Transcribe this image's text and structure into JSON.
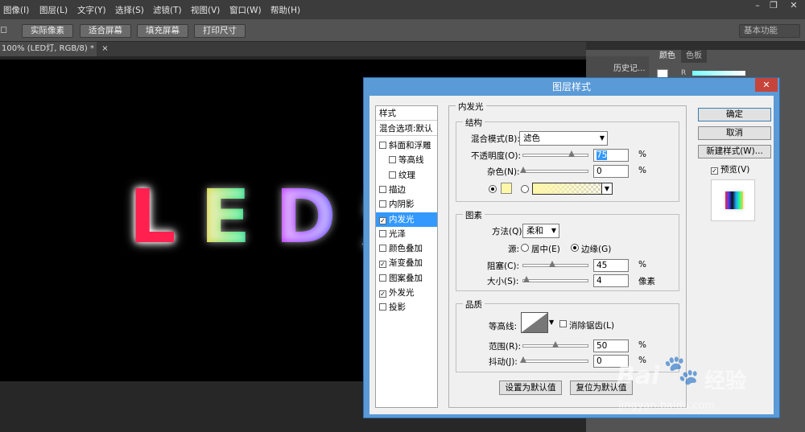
{
  "menu": [
    "图像(I)",
    "图层(L)",
    "文字(Y)",
    "选择(S)",
    "滤镜(T)",
    "视图(V)",
    "窗口(W)",
    "帮助(H)"
  ],
  "options_bar": {
    "buttons": [
      "实际像素",
      "适合屏幕",
      "填充屏幕",
      "打印尺寸"
    ],
    "workspace": "基本功能"
  },
  "document_tab": {
    "title": "100% (LED灯, RGB/8) *",
    "close": "×"
  },
  "canvas_text": "LED灯",
  "right_panel": {
    "history_tab": "历史记...",
    "color_tab": "颜色",
    "swatches_tab": "色板",
    "r_label": "R"
  },
  "dialog": {
    "title": "图层样式",
    "close": "✕",
    "styles_header": "样式",
    "blend_default": "混合选项:默认",
    "styles": [
      {
        "label": "斜面和浮雕",
        "checked": false,
        "indent": false,
        "selected": false
      },
      {
        "label": "等高线",
        "checked": false,
        "indent": true,
        "selected": false
      },
      {
        "label": "纹理",
        "checked": false,
        "indent": true,
        "selected": false
      },
      {
        "label": "描边",
        "checked": false,
        "indent": false,
        "selected": false
      },
      {
        "label": "内阴影",
        "checked": false,
        "indent": false,
        "selected": false
      },
      {
        "label": "内发光",
        "checked": true,
        "indent": false,
        "selected": true
      },
      {
        "label": "光泽",
        "checked": false,
        "indent": false,
        "selected": false
      },
      {
        "label": "颜色叠加",
        "checked": false,
        "indent": false,
        "selected": false
      },
      {
        "label": "渐变叠加",
        "checked": true,
        "indent": false,
        "selected": false
      },
      {
        "label": "图案叠加",
        "checked": false,
        "indent": false,
        "selected": false
      },
      {
        "label": "外发光",
        "checked": true,
        "indent": false,
        "selected": false
      },
      {
        "label": "投影",
        "checked": false,
        "indent": false,
        "selected": false
      }
    ],
    "section_title": "内发光",
    "structure": {
      "title": "结构",
      "blend_mode_label": "混合模式(B):",
      "blend_mode": "滤色",
      "opacity_label": "不透明度(O):",
      "opacity": "75",
      "opacity_pct": 75,
      "noise_label": "杂色(N):",
      "noise": "0",
      "noise_pct": 0,
      "unit": "%",
      "glow_color": "#fff7a8"
    },
    "elements": {
      "title": "图素",
      "method_label": "方法(Q):",
      "method": "柔和",
      "source_label": "源:",
      "center_label": "居中(E)",
      "edge_label": "边缘(G)",
      "choke_label": "阻塞(C):",
      "choke": "45",
      "choke_pct": 45,
      "size_label": "大小(S):",
      "size": "4",
      "size_unit": "像素"
    },
    "quality": {
      "title": "品质",
      "contour_label": "等高线:",
      "antialias_label": "消除锯齿(L)",
      "range_label": "范围(R):",
      "range": "50",
      "range_pct": 50,
      "jitter_label": "抖动(J):",
      "jitter": "0",
      "jitter_pct": 0
    },
    "set_default": "设置为默认值",
    "reset_default": "复位为默认值",
    "ok": "确定",
    "cancel": "取消",
    "new_style": "新建样式(W)...",
    "preview_label": "预览(V)"
  },
  "watermark": {
    "brand": "Bai",
    "brand2": "经验",
    "url": "jingyan.baidu.com"
  }
}
